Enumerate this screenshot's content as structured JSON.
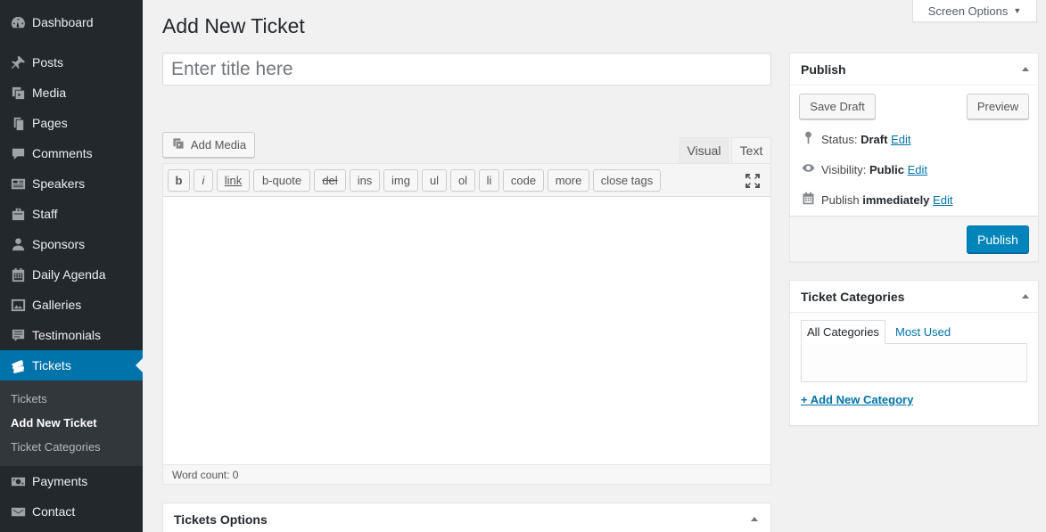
{
  "sidebar": {
    "items": [
      {
        "label": "Dashboard",
        "icon": "dashboard-icon"
      },
      {
        "label": "Posts",
        "icon": "pin-icon"
      },
      {
        "label": "Media",
        "icon": "media-icon"
      },
      {
        "label": "Pages",
        "icon": "pages-icon"
      },
      {
        "label": "Comments",
        "icon": "comments-icon"
      },
      {
        "label": "Speakers",
        "icon": "id-card-icon"
      },
      {
        "label": "Staff",
        "icon": "briefcase-icon"
      },
      {
        "label": "Sponsors",
        "icon": "user-icon"
      },
      {
        "label": "Daily Agenda",
        "icon": "calendar-icon"
      },
      {
        "label": "Galleries",
        "icon": "gallery-icon"
      },
      {
        "label": "Testimonials",
        "icon": "testimonial-icon"
      },
      {
        "label": "Tickets",
        "icon": "tickets-icon"
      },
      {
        "label": "Payments",
        "icon": "money-icon"
      },
      {
        "label": "Contact",
        "icon": "email-icon"
      }
    ],
    "submenu": [
      "Tickets",
      "Add New Ticket",
      "Ticket Categories"
    ]
  },
  "header": {
    "screen_options": "Screen Options",
    "page_title": "Add New Ticket"
  },
  "editor": {
    "title_placeholder": "Enter title here",
    "add_media": "Add Media",
    "tab_visual": "Visual",
    "tab_text": "Text",
    "quicktags": [
      "b",
      "i",
      "link",
      "b-quote",
      "del",
      "ins",
      "img",
      "ul",
      "ol",
      "li",
      "code",
      "more",
      "close tags"
    ],
    "word_count": "Word count: 0"
  },
  "publish": {
    "title": "Publish",
    "save_draft": "Save Draft",
    "preview": "Preview",
    "status_label": "Status:",
    "status_value": "Draft",
    "visibility_label": "Visibility:",
    "visibility_value": "Public",
    "publish_label": "Publish",
    "publish_value": "immediately",
    "edit": "Edit",
    "publish_button": "Publish"
  },
  "categories": {
    "title": "Ticket Categories",
    "tab_all": "All Categories",
    "tab_used": "Most Used",
    "add_new": "+ Add New Category"
  },
  "tickets_options": {
    "title": "Tickets Options"
  },
  "colors": {
    "accent": "#0073aa",
    "sidebar_bg": "#23282d",
    "primary_button": "#0085ba"
  }
}
